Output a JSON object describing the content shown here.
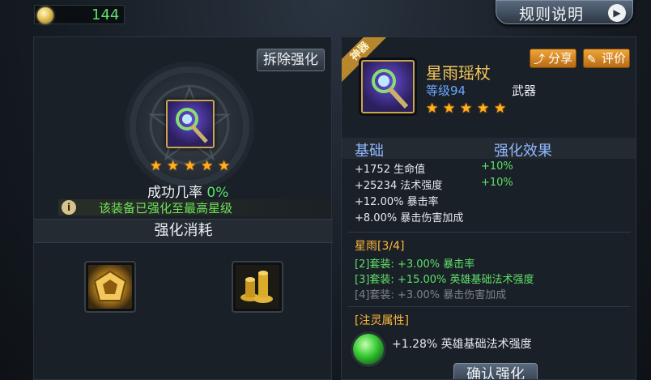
{
  "currency": {
    "icon": "gold-coin-icon",
    "amount": "144"
  },
  "header": {
    "rules_label": "规则说明",
    "rules_arrow": "▶"
  },
  "left": {
    "remove_label": "拆除强化",
    "stars": [
      "★",
      "★",
      "★",
      "★",
      "★"
    ],
    "success_label": "成功几率",
    "success_value": "0%",
    "info_icon": "i",
    "info_text": "该装备已强化至最高星级",
    "cost_title": "强化消耗",
    "cost_items": [
      "enhance-stone-icon",
      "gold-pile-icon"
    ]
  },
  "right": {
    "ribbon": "神器",
    "share_label": "分享",
    "rate_label": "评价",
    "item_name": "星雨瑶杖",
    "level": "等级94",
    "type": "武器",
    "stars": [
      "★",
      "★",
      "★",
      "★",
      "★"
    ],
    "col_base": "基础",
    "col_effect": "强化效果",
    "stats": [
      {
        "text": "+1752 生命值",
        "bonus": "+10%"
      },
      {
        "text": "+25234 法术强度",
        "bonus": "+10%"
      },
      {
        "text": "+12.00% 暴击率",
        "bonus": ""
      },
      {
        "text": "+8.00% 暴击伤害加成",
        "bonus": ""
      }
    ],
    "set_title": "星雨[3/4]",
    "set_bonuses": [
      {
        "text": "[2]套装: +3.00% 暴击率",
        "active": true
      },
      {
        "text": "[3]套装: +15.00% 英雄基础法术强度",
        "active": true
      },
      {
        "text": "[4]套装: +3.00% 暴击伤害加成",
        "active": false
      }
    ],
    "spirit_title": "[注灵属性]",
    "spirit_text": "+1.28% 英雄基础法术强度",
    "confirm_label": "确认强化"
  }
}
